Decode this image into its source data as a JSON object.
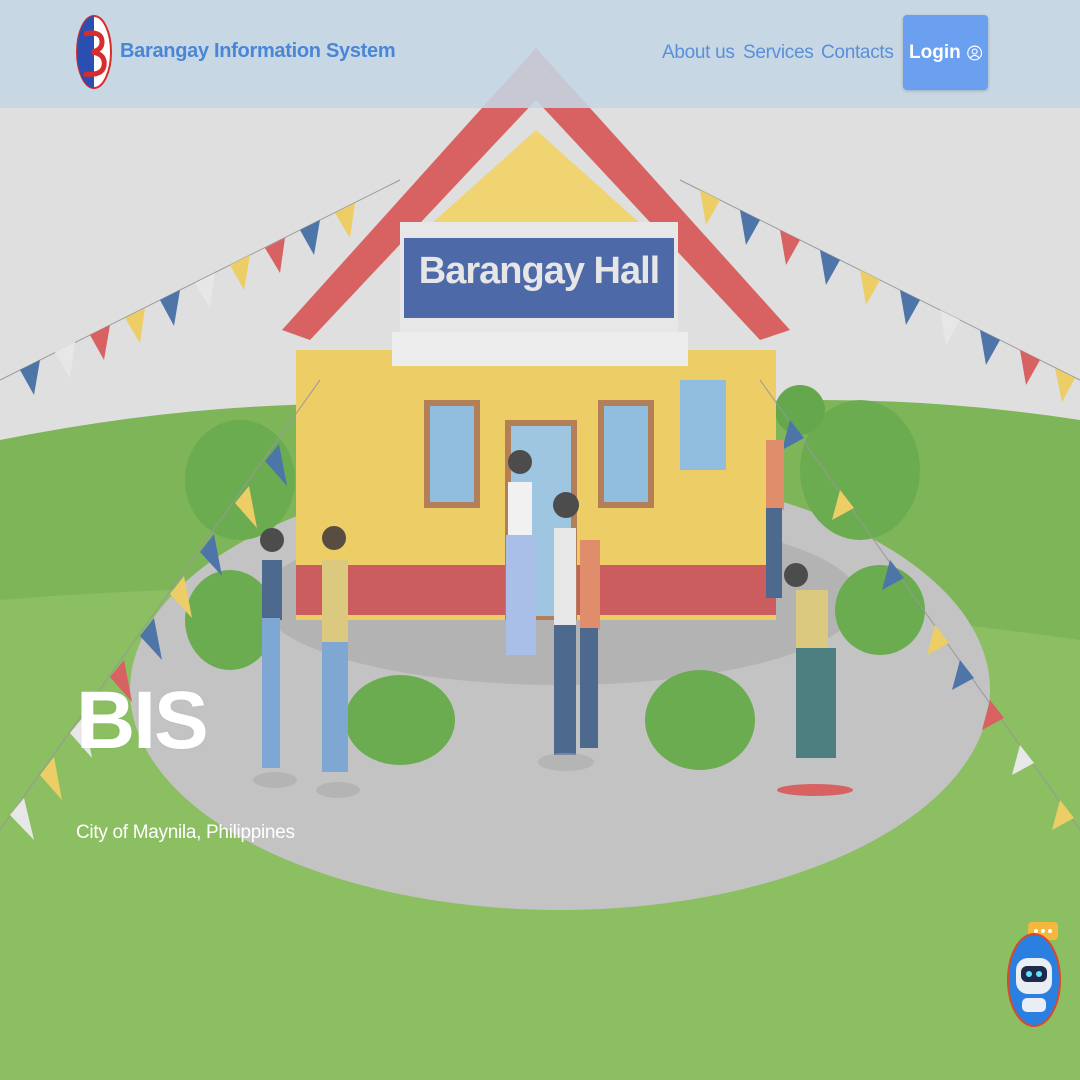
{
  "header": {
    "brand": "Barangay Information System",
    "nav": [
      {
        "label": "About us"
      },
      {
        "label": "Services"
      },
      {
        "label": "Contacts"
      }
    ],
    "login_label": "Login"
  },
  "hero": {
    "title": "BIS",
    "subtitle": "City of Maynila, Philippines",
    "building_sign": "Barangay Hall"
  },
  "colors": {
    "accent": "#6b9ff0",
    "nav_text": "#5a8fd9",
    "grass": "#5fa534",
    "roof": "#d64545",
    "sign": "#2e4f9a",
    "wall": "#f0c84a"
  },
  "icons": {
    "logo": "barangay-logo",
    "login": "user-circle-icon",
    "chatbot": "robot-chat-icon"
  }
}
